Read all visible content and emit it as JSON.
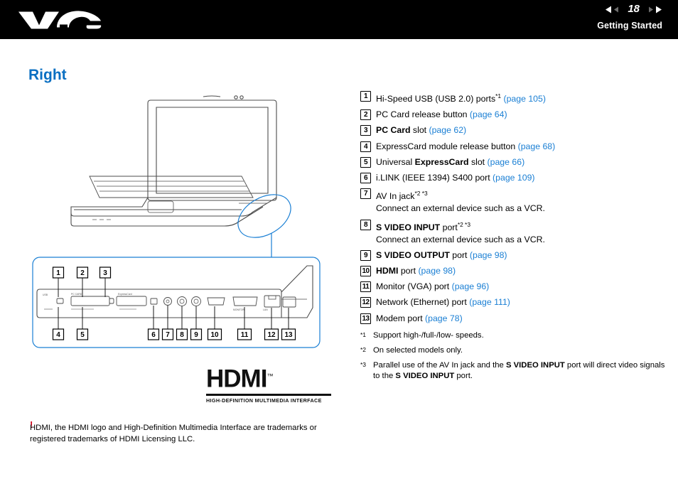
{
  "header": {
    "page_number": "18",
    "section": "Getting Started",
    "logo": "vaio-logo",
    "prev_icon": "prev-arrow-icon",
    "next_icon": "next-arrow-icon"
  },
  "page_title": "Right",
  "illustration": {
    "alt": "VAIO notebook right-side port diagram",
    "callout_numbers_top": [
      "1",
      "2",
      "3"
    ],
    "callout_numbers_bottom": [
      "4",
      "5",
      "6",
      "7",
      "8",
      "9",
      "10",
      "11",
      "12",
      "13"
    ],
    "hdmi_logo": {
      "word": "HDMI",
      "tm": "™",
      "subtitle": "HIGH-DEFINITION MULTIMEDIA INTERFACE"
    }
  },
  "items": [
    {
      "num": "1",
      "pre": "Hi-Speed USB (USB 2.0) ports",
      "sup": "*1",
      "ref": "(page 105)",
      "post": ""
    },
    {
      "num": "2",
      "pre": "PC Card release button ",
      "sup": "",
      "ref": "(page 64)",
      "post": ""
    },
    {
      "num": "3",
      "bold_lead": "PC Card",
      "pre": " slot ",
      "sup": "",
      "ref": "(page 62)",
      "post": ""
    },
    {
      "num": "4",
      "pre": "ExpressCard module release button ",
      "sup": "",
      "ref": "(page 68)",
      "post": ""
    },
    {
      "num": "5",
      "pre": "Universal ",
      "bold_mid": "ExpressCard",
      "post_mid": " slot ",
      "ref": "(page 66)",
      "post": ""
    },
    {
      "num": "6",
      "pre": "i.LINK (IEEE 1394) S400 port ",
      "sup": "",
      "ref": "(page 109)",
      "post": ""
    },
    {
      "num": "7",
      "pre": "AV In jack",
      "sup": "*2 *3",
      "ref": "",
      "post": "",
      "second_line": "Connect an external device such as a VCR."
    },
    {
      "num": "8",
      "bold_lead": "S VIDEO INPUT",
      "pre": " port",
      "sup": "*2 *3",
      "ref": "",
      "post": "",
      "second_line": "Connect an external device such as a VCR."
    },
    {
      "num": "9",
      "bold_lead": "S VIDEO OUTPUT",
      "pre": " port ",
      "sup": "",
      "ref": "(page 98)",
      "post": ""
    },
    {
      "num": "10",
      "bold_lead": "HDMI",
      "pre": " port ",
      "sup": "",
      "ref": "(page 98)",
      "post": ""
    },
    {
      "num": "11",
      "pre": "Monitor (VGA) port ",
      "sup": "",
      "ref": "(page 96)",
      "post": ""
    },
    {
      "num": "12",
      "pre": "Network (Ethernet) port ",
      "sup": "",
      "ref": "(page 111)",
      "post": ""
    },
    {
      "num": "13",
      "pre": "Modem port ",
      "sup": "",
      "ref": "(page 78)",
      "post": ""
    }
  ],
  "footnotes": [
    {
      "mark": "*1",
      "text": "Support high-/full-/low- speeds."
    },
    {
      "mark": "*2",
      "text": "On selected models only."
    },
    {
      "mark": "*3",
      "text_a": "Parallel use of the AV In jack and the ",
      "bold_a": "S VIDEO INPUT",
      "text_b": " port will direct video signals to the ",
      "bold_b": "S VIDEO INPUT",
      "text_c": " port."
    }
  ],
  "trademark_note": {
    "warning_mark": "!",
    "text": "HDMI, the HDMI logo and High-Definition Multimedia Interface are trademarks or registered trademarks of HDMI Licensing LLC."
  }
}
